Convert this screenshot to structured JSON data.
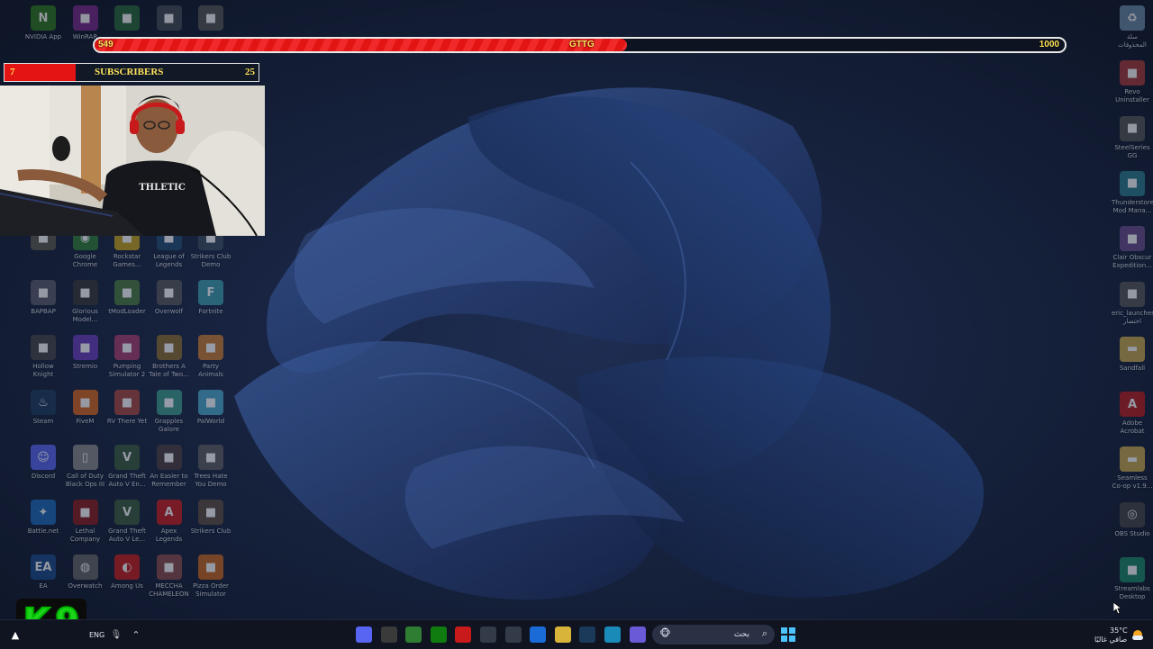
{
  "stream_overlay": {
    "goal": {
      "current": "549",
      "label": "GTTG",
      "target": "1000",
      "progress": 0.549
    },
    "subscribers": {
      "current": "7",
      "label": "SUBSCRIBERS",
      "target": "25",
      "progress": 0.28
    },
    "logo": {
      "letter": "K",
      "digit": "9"
    },
    "webcam_shirt_text": "THLETIC"
  },
  "desktop": {
    "left_icons": [
      {
        "label": "NVIDIA App",
        "icon": "nvidia-icon",
        "color": "#2f7a1f"
      },
      {
        "label": "WinRAR",
        "icon": "winrar-icon",
        "color": "#7a2a8c"
      },
      {
        "label": "",
        "icon": "game-icon",
        "color": "#2a6a3a"
      },
      {
        "label": "",
        "icon": "game-icon",
        "color": "#444a55"
      },
      {
        "label": "",
        "icon": "notion-icon",
        "color": "#555"
      },
      {
        "label": "",
        "icon": "game-icon",
        "color": "#5a5a4a"
      },
      {
        "label": "Google\nChrome",
        "icon": "chrome-icon",
        "color": "#2e7d32"
      },
      {
        "label": "Rockstar\nGames...",
        "icon": "rockstar-icon",
        "color": "#c8a21a"
      },
      {
        "label": "League of\nLegends",
        "icon": "lol-icon",
        "color": "#1f4a6e"
      },
      {
        "label": "Strikers Club\nDemo",
        "icon": "game-icon",
        "color": "#3a4a5a"
      },
      {
        "label": "BAPBAP",
        "icon": "game-icon",
        "color": "#5a5a6a"
      },
      {
        "label": "Glorious\nModel...",
        "icon": "mouse-icon",
        "color": "#333"
      },
      {
        "label": "tModLoader",
        "icon": "tmod-icon",
        "color": "#4a7a3a"
      },
      {
        "label": "Overwolf",
        "icon": "overwolf-icon",
        "color": "#555"
      },
      {
        "label": "Fortnite",
        "icon": "fortnite-icon",
        "color": "#3a9aa8"
      },
      {
        "label": "Hollow\nKnight",
        "icon": "hollow-knight-icon",
        "color": "#444"
      },
      {
        "label": "Stremio",
        "icon": "stremio-icon",
        "color": "#6a3ab8"
      },
      {
        "label": "Pumping\nSimulator 2",
        "icon": "game-icon",
        "color": "#a83a6a"
      },
      {
        "label": "Brothers A\nTale of Two...",
        "icon": "game-icon",
        "color": "#8a6a2a"
      },
      {
        "label": "Party Animals",
        "icon": "game-icon",
        "color": "#c87a2a"
      },
      {
        "label": "Steam",
        "icon": "steam-icon",
        "color": "#1b3a5a"
      },
      {
        "label": "FiveM",
        "icon": "fivem-icon",
        "color": "#d8641a"
      },
      {
        "label": "RV There Yet",
        "icon": "game-icon",
        "color": "#a8443a"
      },
      {
        "label": "Grapples\nGalore",
        "icon": "game-icon",
        "color": "#3a9a8a"
      },
      {
        "label": "PalWorld",
        "icon": "game-icon",
        "color": "#4aa8c8"
      },
      {
        "label": "Discord",
        "icon": "discord-icon",
        "color": "#5865f2"
      },
      {
        "label": "Call of Duty\nBlack Ops III",
        "icon": "file-icon",
        "color": "#888"
      },
      {
        "label": "Grand Theft\nAuto V En...",
        "icon": "gta-icon",
        "color": "#3a5a3a"
      },
      {
        "label": "An Easier to\nRemember",
        "icon": "game-icon",
        "color": "#4a3a3a"
      },
      {
        "label": "Trees Hate\nYou Demo",
        "icon": "game-icon",
        "color": "#5a5a5a"
      },
      {
        "label": "Battle.net",
        "icon": "battlenet-icon",
        "color": "#1a6ab8"
      },
      {
        "label": "Lethal\nCompany",
        "icon": "game-icon",
        "color": "#8a1a1a"
      },
      {
        "label": "Grand Theft\nAuto V Le...",
        "icon": "gta-icon",
        "color": "#3a5a3a"
      },
      {
        "label": "Apex\nLegends",
        "icon": "apex-icon",
        "color": "#c81a1a"
      },
      {
        "label": "Strikers Club",
        "icon": "game-icon",
        "color": "#5a4a3a"
      },
      {
        "label": "EA",
        "icon": "ea-icon",
        "color": "#1a4a8a"
      },
      {
        "label": "Overwatch",
        "icon": "overwatch-icon",
        "color": "#666"
      },
      {
        "label": "Among Us",
        "icon": "among-us-icon",
        "color": "#c81a1a"
      },
      {
        "label": "MECCHA\nCHAMELEON",
        "icon": "game-icon",
        "color": "#8a4a4a"
      },
      {
        "label": "Pizza Order\nSimulator",
        "icon": "game-icon",
        "color": "#c8641a"
      }
    ],
    "right_icons": [
      {
        "label": "سلة\nالمحذوفات",
        "icon": "recycle-bin-icon",
        "color": "#6a8aa8"
      },
      {
        "label": "Revo\nUninstaller",
        "icon": "revo-icon",
        "color": "#a83a3a"
      },
      {
        "label": "SteelSeries\nGG",
        "icon": "steelseries-icon",
        "color": "#555"
      },
      {
        "label": "Thunderstore\nMod Mana...",
        "icon": "thunderstore-icon",
        "color": "#2a7a8a"
      },
      {
        "label": "Clair Obscur\nExpedition...",
        "icon": "game-icon",
        "color": "#6a4a8a"
      },
      {
        "label": "eric_launcher\nاختصار",
        "icon": "launcher-icon",
        "color": "#555"
      },
      {
        "label": "Sandfall",
        "icon": "folder-icon",
        "color": "#c8a84a"
      },
      {
        "label": "Adobe\nAcrobat",
        "icon": "acrobat-icon",
        "color": "#b81a1a"
      },
      {
        "label": "Seamless\nCo-op v1.9...",
        "icon": "folder-icon",
        "color": "#c8a84a"
      },
      {
        "label": "OBS Studio",
        "icon": "obs-icon",
        "color": "#444"
      },
      {
        "label": "Streamlabs\nDesktop",
        "icon": "streamlabs-icon",
        "color": "#1a8a6a"
      }
    ]
  },
  "taskbar": {
    "language": "ENG",
    "search_placeholder": "بحث",
    "temperature": "35°C",
    "weather": "صافي غالبًا",
    "apps": [
      {
        "icon": "discord-icon",
        "color": "#5865f2"
      },
      {
        "icon": "obs-icon",
        "color": "#3a3a3a"
      },
      {
        "icon": "chrome-icon",
        "color": "#2e7d32"
      },
      {
        "icon": "xbox-icon",
        "color": "#107c10"
      },
      {
        "icon": "steelseries-icon",
        "color": "#c81a1a"
      },
      {
        "icon": "app-icon",
        "color": "#333a48"
      },
      {
        "icon": "settings-icon",
        "color": "#333a48"
      },
      {
        "icon": "mail-icon",
        "color": "#1a6ad8"
      },
      {
        "icon": "folder-icon",
        "color": "#d8b43a"
      },
      {
        "icon": "steam-icon",
        "color": "#1b3a5a"
      },
      {
        "icon": "edge-icon",
        "color": "#1a8ab8"
      },
      {
        "icon": "copilot-icon",
        "color": "#6a5ad8"
      }
    ]
  }
}
